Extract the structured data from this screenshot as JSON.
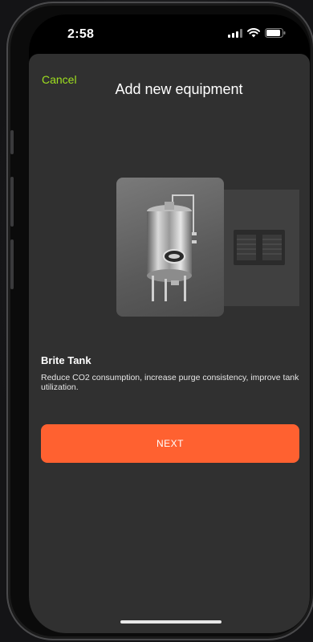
{
  "status_bar": {
    "time": "2:58",
    "icons": [
      "signal-icon",
      "wifi-icon",
      "battery-icon"
    ]
  },
  "header": {
    "cancel_label": "Cancel",
    "title": "Add new equipment"
  },
  "carousel": {
    "items": [
      {
        "name": "Brite Tank",
        "icon": "brite-tank-image"
      },
      {
        "name": "",
        "icon": "generator-unit-image"
      }
    ]
  },
  "equipment": {
    "name": "Brite Tank",
    "description": "Reduce CO2 consumption, increase purge consistency, improve tank utilization."
  },
  "actions": {
    "next_label": "NEXT"
  },
  "colors": {
    "accent": "#9fe01f",
    "primary_button": "#ff6130",
    "sheet_background": "#303030"
  }
}
